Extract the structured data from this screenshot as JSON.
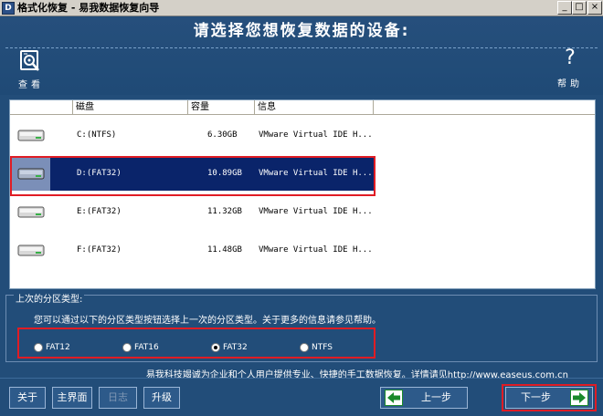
{
  "window": {
    "title": "格式化恢复 - 易我数据恢复向导",
    "app_icon_text": "D",
    "min_glyph": "_",
    "max_glyph": "□",
    "close_glyph": "×"
  },
  "header": {
    "heading": "请选择您想恢复数据的设备:",
    "view_label": "查看",
    "help_label": "帮助",
    "help_glyph": "?"
  },
  "columns": [
    "磁盘",
    "容量",
    "信息"
  ],
  "devices": [
    {
      "name": "C:(NTFS)",
      "size": "6.30GB",
      "info": "VMware Virtual IDE H..."
    },
    {
      "name": "D:(FAT32)",
      "size": "10.89GB",
      "info": "VMware Virtual IDE H...",
      "selected": true
    },
    {
      "name": "E:(FAT32)",
      "size": "11.32GB",
      "info": "VMware Virtual IDE H..."
    },
    {
      "name": "F:(FAT32)",
      "size": "11.48GB",
      "info": "VMware Virtual IDE H..."
    }
  ],
  "partition": {
    "title": "上次的分区类型:",
    "description": "您可以通过以下的分区类型按钮选择上一次的分区类型。关于更多的信息请参见帮助。",
    "options": [
      "FAT12",
      "FAT16",
      "FAT32",
      "NTFS"
    ],
    "selected": "FAT32"
  },
  "footer": {
    "text": "易我科技竭诚为企业和个人用户提供专业、快捷的手工数据恢复。详情请见http://www.easeus.com.cn",
    "about": "关于",
    "main": "主界面",
    "log": "日志",
    "upgrade": "升级",
    "prev": "上一步",
    "next": "下一步"
  },
  "colors": {
    "background": "#224d79",
    "selection": "#0a246a",
    "highlight_outline": "#e01c24",
    "arrow_green": "#1a8a2a"
  }
}
